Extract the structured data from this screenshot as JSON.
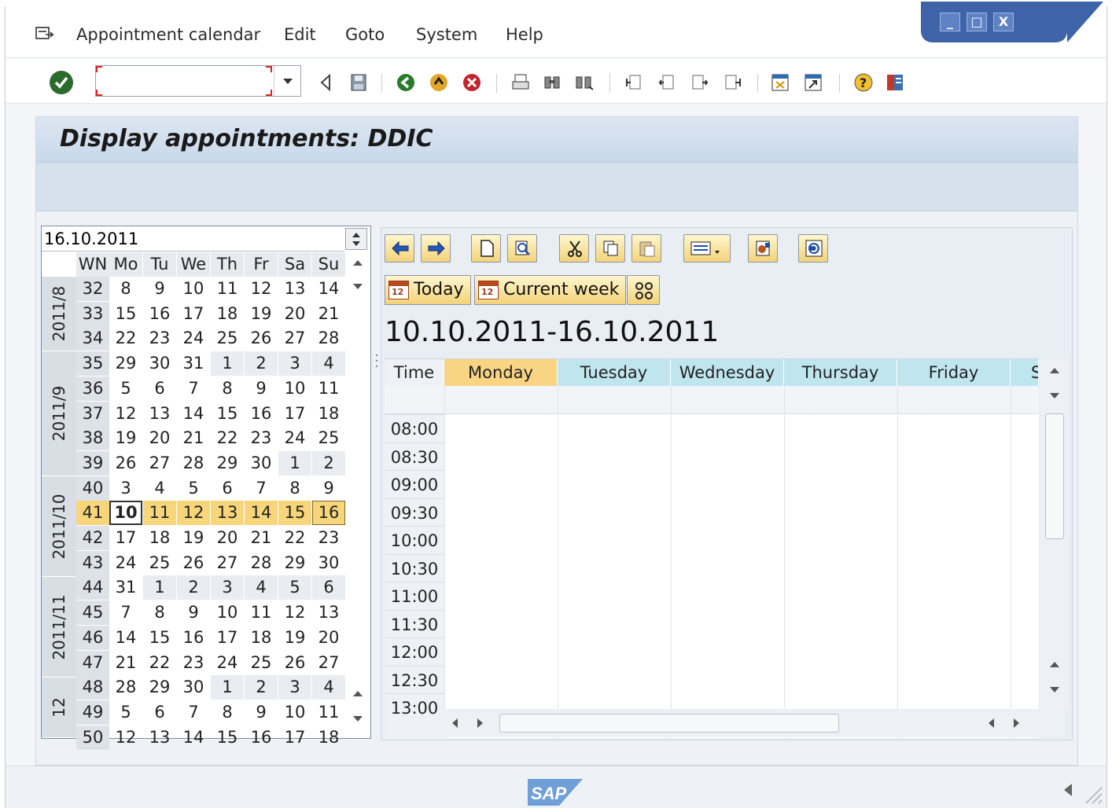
{
  "menubar": {
    "items": [
      "Appointment calendar",
      "Edit",
      "Goto",
      "System",
      "Help"
    ]
  },
  "window_controls": {
    "minimize": "_",
    "maximize": "□",
    "close": "X"
  },
  "toolbar": {
    "command_placeholder": "",
    "icons": [
      "enter-icon",
      "back-icon",
      "save-icon",
      "green-arrow-back-icon",
      "exit-icon",
      "cancel-icon",
      "print-icon",
      "find-icon",
      "find-next-icon",
      "first-page-icon",
      "previous-page-icon",
      "next-page-icon",
      "last-page-icon",
      "create-session-icon",
      "shortcut-icon",
      "help-icon",
      "customize-layout-icon"
    ]
  },
  "page": {
    "title": "Display appointments: DDIC"
  },
  "navigator": {
    "date_value": "16.10.2011",
    "headers": [
      "WN",
      "Mo",
      "Tu",
      "We",
      "Th",
      "Fr",
      "Sa",
      "Su"
    ],
    "months": [
      {
        "label": "2011/8"
      },
      {
        "label": "2011/9"
      },
      {
        "label": "2011/10"
      },
      {
        "label": "2011/11"
      },
      {
        "label": "12"
      }
    ],
    "weeks": [
      {
        "wn": "32",
        "days": [
          "8",
          "9",
          "10",
          "11",
          "12",
          "13",
          "14"
        ]
      },
      {
        "wn": "33",
        "days": [
          "15",
          "16",
          "17",
          "18",
          "19",
          "20",
          "21"
        ]
      },
      {
        "wn": "34",
        "days": [
          "22",
          "23",
          "24",
          "25",
          "26",
          "27",
          "28"
        ]
      },
      {
        "wn": "35",
        "days": [
          "29",
          "30",
          "31",
          "1",
          "2",
          "3",
          "4"
        ]
      },
      {
        "wn": "36",
        "days": [
          "5",
          "6",
          "7",
          "8",
          "9",
          "10",
          "11"
        ]
      },
      {
        "wn": "37",
        "days": [
          "12",
          "13",
          "14",
          "15",
          "16",
          "17",
          "18"
        ]
      },
      {
        "wn": "38",
        "days": [
          "19",
          "20",
          "21",
          "22",
          "23",
          "24",
          "25"
        ]
      },
      {
        "wn": "39",
        "days": [
          "26",
          "27",
          "28",
          "29",
          "30",
          "1",
          "2"
        ]
      },
      {
        "wn": "40",
        "days": [
          "3",
          "4",
          "5",
          "6",
          "7",
          "8",
          "9"
        ]
      },
      {
        "wn": "41",
        "days": [
          "10",
          "11",
          "12",
          "13",
          "14",
          "15",
          "16"
        ]
      },
      {
        "wn": "42",
        "days": [
          "17",
          "18",
          "19",
          "20",
          "21",
          "22",
          "23"
        ]
      },
      {
        "wn": "43",
        "days": [
          "24",
          "25",
          "26",
          "27",
          "28",
          "29",
          "30"
        ]
      },
      {
        "wn": "44",
        "days": [
          "31",
          "1",
          "2",
          "3",
          "4",
          "5",
          "6"
        ]
      },
      {
        "wn": "45",
        "days": [
          "7",
          "8",
          "9",
          "10",
          "11",
          "12",
          "13"
        ]
      },
      {
        "wn": "46",
        "days": [
          "14",
          "15",
          "16",
          "17",
          "18",
          "19",
          "20"
        ]
      },
      {
        "wn": "47",
        "days": [
          "21",
          "22",
          "23",
          "24",
          "25",
          "26",
          "27"
        ]
      },
      {
        "wn": "48",
        "days": [
          "28",
          "29",
          "30",
          "1",
          "2",
          "3",
          "4"
        ]
      },
      {
        "wn": "49",
        "days": [
          "5",
          "6",
          "7",
          "8",
          "9",
          "10",
          "11"
        ]
      },
      {
        "wn": "50",
        "days": [
          "12",
          "13",
          "14",
          "15",
          "16",
          "17",
          "18"
        ]
      }
    ]
  },
  "calendar": {
    "today_button": "Today",
    "current_week_button": "Current week",
    "range": "10.10.2011-16.10.2011",
    "columns": [
      "Time",
      "Monday",
      "Tuesday",
      "Wednesday",
      "Thursday",
      "Friday",
      "S"
    ],
    "times": [
      "08:00",
      "08:30",
      "09:00",
      "09:30",
      "10:00",
      "10:30",
      "11:00",
      "11:30",
      "12:00",
      "12:30",
      "13:00"
    ],
    "icon_badge": "12"
  },
  "footer": {
    "logo_text": "SAP"
  },
  "colors": {
    "selected_week": "#f7d57a",
    "day_header": "#bfe6ef",
    "monday_header": "#f9d483",
    "frame_blue": "#3f63a8"
  }
}
